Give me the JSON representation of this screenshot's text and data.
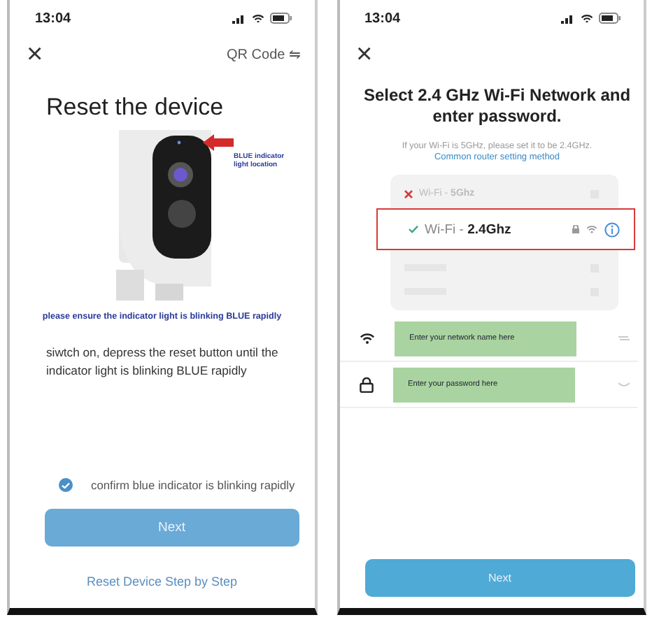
{
  "left_screen": {
    "status_time": "13:04",
    "close": "×",
    "qr_link": "QR Code ⇋",
    "title": "Reset the device",
    "annotation": "BLUE indicator light location",
    "caption": "please ensure the indicator light is blinking BLUE rapidly",
    "instruction": "siwtch on, depress the reset button until the indicator light is blinking BLUE rapidly",
    "confirm": {
      "label": "confirm blue indicator is blinking rapidly",
      "checked": true
    },
    "next_button": "Next",
    "reset_link": "Reset Device Step by Step"
  },
  "right_screen": {
    "status_time": "13:04",
    "close": "×",
    "title": "Select 2.4 GHz Wi-Fi Network and enter password.",
    "hint": "If your Wi-Fi is 5GHz, please set it to be 2.4GHz.",
    "router_link": "Common router setting method",
    "networks": [
      {
        "kind": "network",
        "name": "Wi-Fi - **5Ghz**",
        "selected": false
      },
      {
        "kind": "network",
        "name": "Wi-Fi - **2.4Ghz**",
        "selected": true
      },
      {
        "kind": "blank"
      },
      {
        "kind": "blank"
      }
    ],
    "fields": [
      {
        "kind": "network",
        "placeholder": "Enter your network name here"
      },
      {
        "kind": "password",
        "placeholder": "Enter your password here"
      }
    ],
    "next_button": "Next"
  }
}
